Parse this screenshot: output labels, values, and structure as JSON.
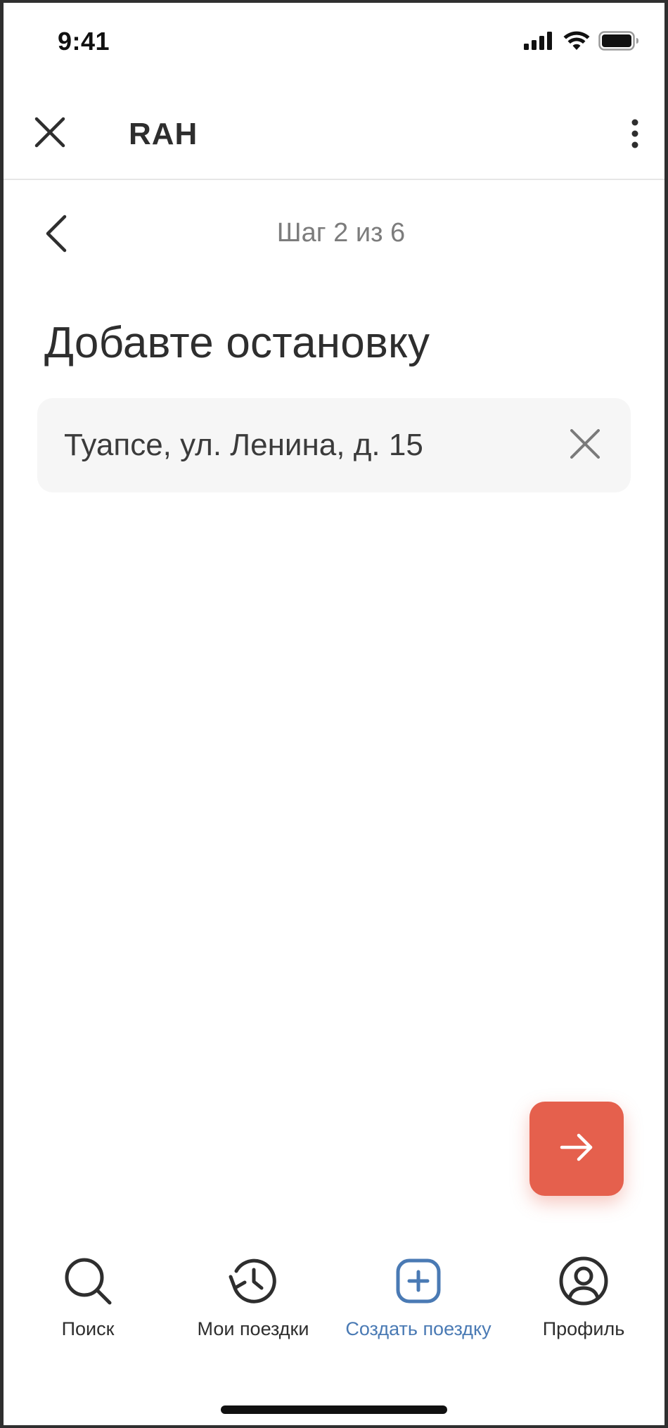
{
  "status_bar": {
    "time": "9:41"
  },
  "header": {
    "title": "RAH"
  },
  "step": {
    "indicator": "Шаг 2 из 6"
  },
  "page": {
    "title": "Добавте остановку"
  },
  "address": {
    "value": "Туапсе, ул. Ленина, д. 15"
  },
  "colors": {
    "accent": "#e5604d",
    "active_tab": "#4a7ab4",
    "text": "#2e2e2e",
    "muted": "#7c7c7c",
    "field_bg": "#f6f6f6"
  },
  "bottom_nav": {
    "items": [
      {
        "label": "Поиск",
        "icon": "search-icon",
        "active": false
      },
      {
        "label": "Мои поездки",
        "icon": "history-icon",
        "active": false
      },
      {
        "label": "Создать поездку",
        "icon": "plus-square-icon",
        "active": true
      },
      {
        "label": "Профиль",
        "icon": "user-circle-icon",
        "active": false
      }
    ]
  }
}
